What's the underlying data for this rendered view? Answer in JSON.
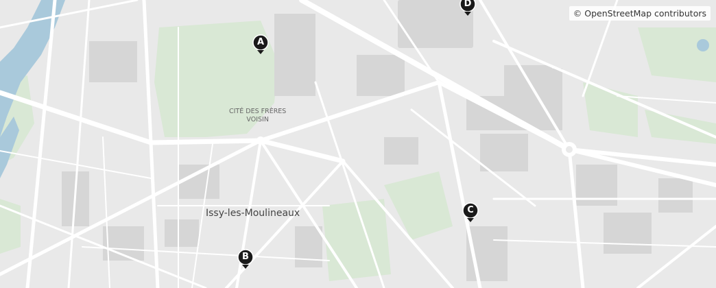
{
  "map": {
    "attribution": "© OpenStreetMap contributors",
    "places": {
      "town": "Issy-les-Moulineaux",
      "district_line1": "CITÉ DES FRÈRES",
      "district_line2": "VOISIN"
    },
    "markers": [
      {
        "id": "A",
        "label": "A"
      },
      {
        "id": "B",
        "label": "B"
      },
      {
        "id": "C",
        "label": "C"
      },
      {
        "id": "D",
        "label": "D"
      }
    ],
    "colors": {
      "land": "#e9e9e9",
      "roads": "#ffffff",
      "water": "#a9c9db",
      "parks": "#d9e8d5",
      "buildings": "#d5d5d5",
      "marker": "#1a1a1a"
    }
  }
}
